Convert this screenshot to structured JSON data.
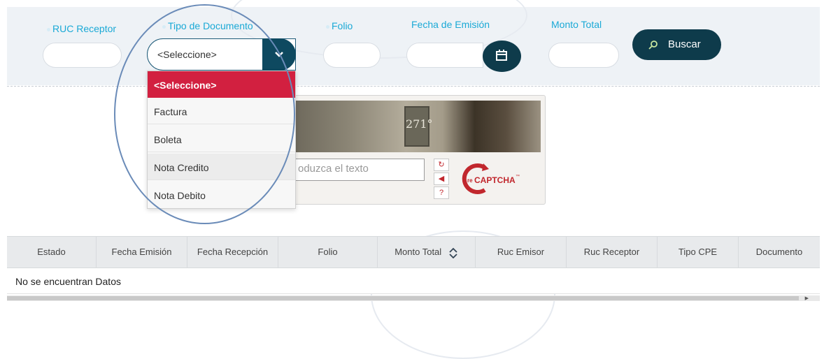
{
  "filters": {
    "ruc_receptor": {
      "label": "RUC Receptor",
      "value": ""
    },
    "tipo_documento": {
      "label": "Tipo de Documento",
      "value": "<Seleccione>"
    },
    "folio": {
      "label": "Folio",
      "value": ""
    },
    "fecha_emision": {
      "label": "Fecha de Emisión",
      "value": ""
    },
    "monto_total": {
      "label": "Monto Total",
      "value": ""
    },
    "buscar_label": "Buscar"
  },
  "dropdown": {
    "options": [
      "<Seleccione>",
      "Factura",
      "Boleta",
      "Nota Credito",
      "Nota Debito"
    ],
    "selected_index": 0,
    "hover_index": 3
  },
  "captcha": {
    "image_text": "271°",
    "input_placeholder": "oduzca el texto",
    "logo_text": "CAPTCHA",
    "logo_prefix": "re",
    "logo_tm": "™"
  },
  "table": {
    "columns": [
      "Estado",
      "Fecha Emisión",
      "Fecha Recepción",
      "Folio",
      "Monto Total",
      "Ruc Emisor",
      "Ruc Receptor",
      "Tipo CPE",
      "Documento"
    ],
    "empty_message": "No se encuentran Datos"
  },
  "colors": {
    "accent_dark": "#0e3b4b",
    "label_blue": "#1aa9d6",
    "selected_red": "#d22040",
    "highlight_circle": "#6a8bb8"
  },
  "icons": {
    "dropdown": "chevron-down-icon",
    "calendar": "calendar-icon",
    "search": "search-icon",
    "sort": "sort-icon",
    "refresh": "refresh-icon",
    "audio": "audio-icon",
    "help": "help-icon"
  }
}
